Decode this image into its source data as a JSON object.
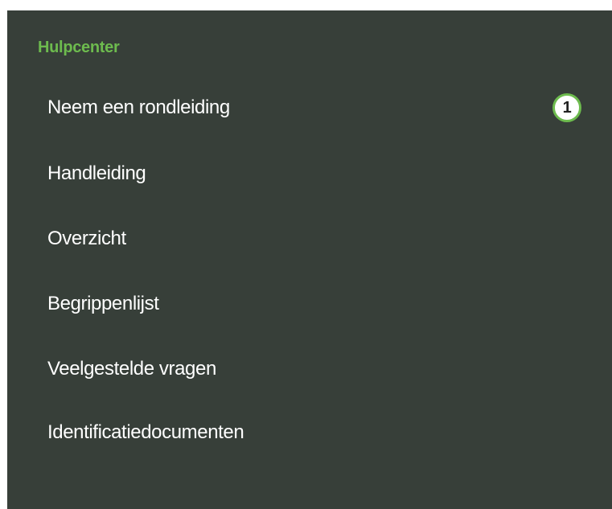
{
  "help_center": {
    "title": "Hulpcenter",
    "items": [
      {
        "label": "Neem een rondleiding",
        "badge": "1"
      },
      {
        "label": "Handleiding"
      },
      {
        "label": "Overzicht"
      },
      {
        "label": "Begrippenlijst"
      },
      {
        "label": "Veelgestelde vragen"
      },
      {
        "label": "Identificatiedocumenten"
      }
    ]
  },
  "colors": {
    "panel_background": "#373f39",
    "accent_green": "#6dbb4e",
    "text": "#ffffff"
  }
}
